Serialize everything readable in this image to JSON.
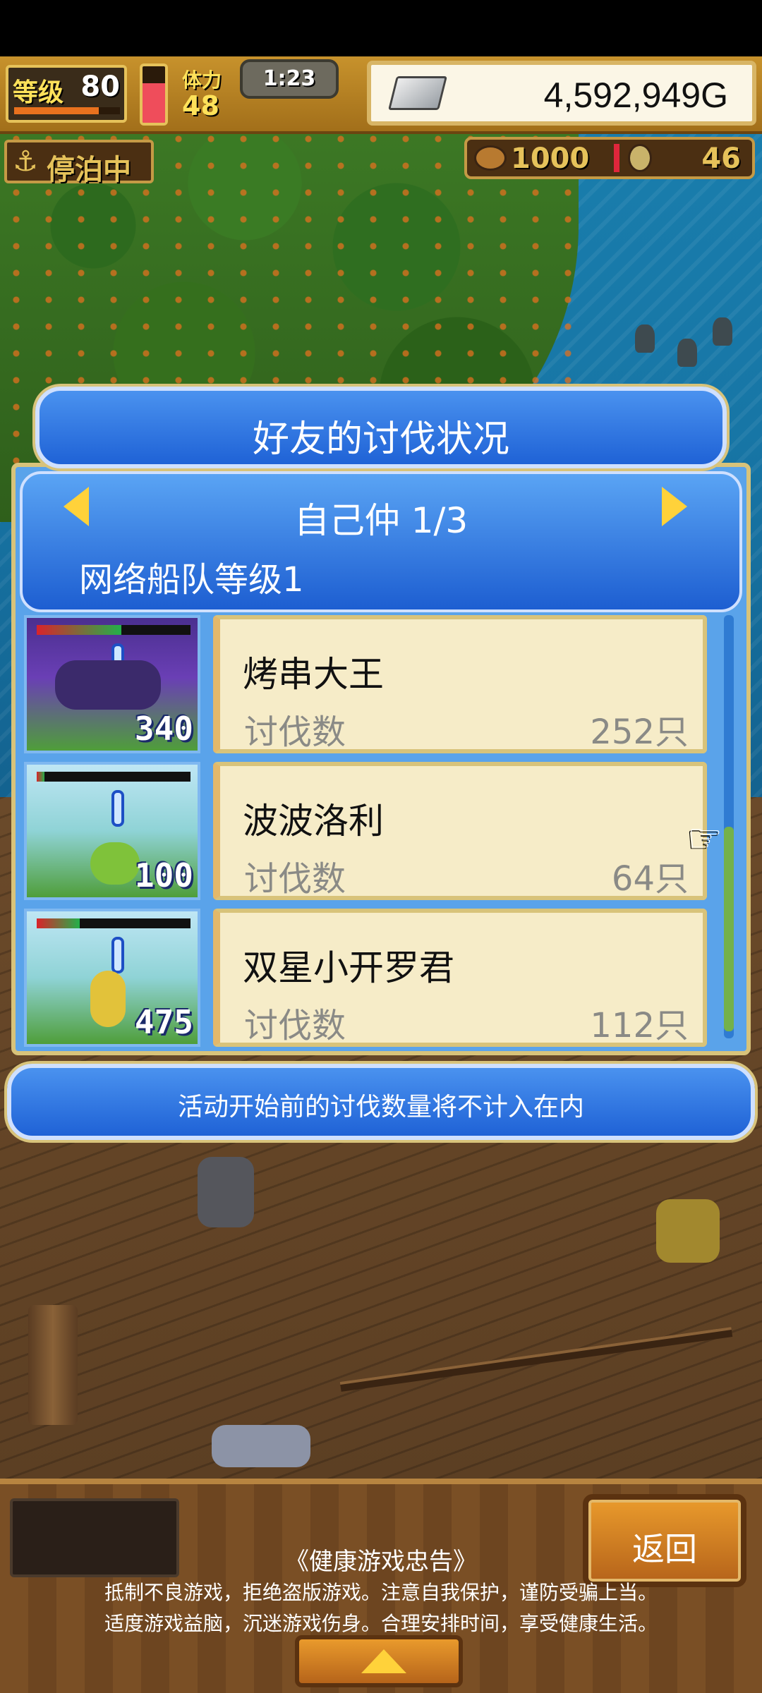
{
  "hud": {
    "level_label": "等级",
    "level_value": "80",
    "level_progress": 0.8,
    "stamina_label": "体力",
    "stamina_value": "48",
    "stamina_fraction": 0.7,
    "timer": "1:23",
    "gold": "4,592,949G",
    "docked_label": "停泊中",
    "food": "1000",
    "medals": "46"
  },
  "dialog": {
    "title": "好友的讨伐状况",
    "page_label": "自己仲 1/3",
    "fleet_level": "网络船队等级1",
    "footer_note": "活动开始前的讨伐数量将不计入在内",
    "kills_label": "讨伐数",
    "entries": [
      {
        "name": "烤串大王",
        "kills": "252只",
        "hp_number": "340",
        "hp_fraction": 0.55
      },
      {
        "name": "波波洛利",
        "kills": "64只",
        "hp_number": "100",
        "hp_fraction": 0.05
      },
      {
        "name": "双星小开罗君",
        "kills": "112只",
        "hp_number": "475",
        "hp_fraction": 0.28
      }
    ]
  },
  "bottom": {
    "back_label": "返回",
    "advice_title": "《健康游戏忠告》",
    "advice_line1": "抵制不良游戏，拒绝盗版游戏。注意自我保护，谨防受骗上当。",
    "advice_line2": "适度游戏益脑，沉迷游戏伤身。合理安排时间，享受健康生活。"
  },
  "colors": {
    "dialog_blue": "#1f62d6",
    "card_cream": "#f6ecc8",
    "gold_accent": "#d8c37a"
  },
  "icons": [
    "silver-bar-icon",
    "anchor-icon",
    "food-icon",
    "medal-icon",
    "arrow-left-icon",
    "arrow-right-icon",
    "hand-cursor-icon",
    "chevron-up-icon"
  ]
}
